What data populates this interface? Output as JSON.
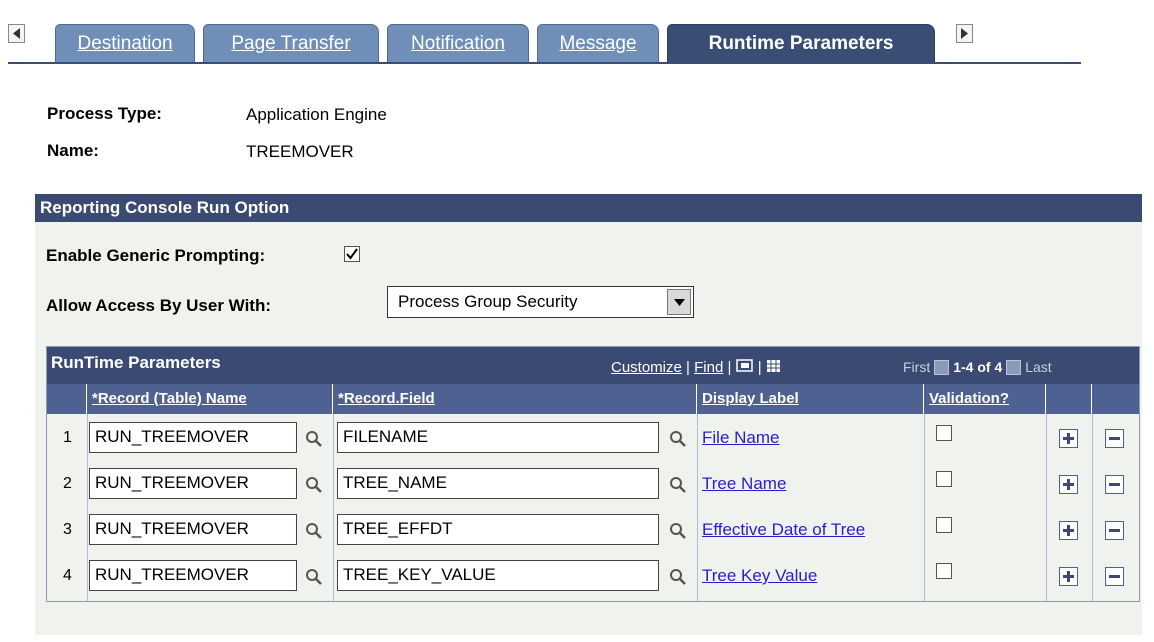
{
  "tabs": {
    "items": [
      {
        "label": "Destination",
        "active": false
      },
      {
        "label": "Page Transfer",
        "active": false
      },
      {
        "label": "Notification",
        "active": false
      },
      {
        "label": "Message",
        "active": false
      },
      {
        "label": "Runtime Parameters",
        "active": true
      }
    ],
    "prev_icon": "triangle-left-icon",
    "next_icon": "triangle-right-icon"
  },
  "info": {
    "process_type_label": "Process Type:",
    "process_type_value": "Application Engine",
    "name_label": "Name:",
    "name_value": "TREEMOVER"
  },
  "section": {
    "title": "Reporting Console Run Option",
    "generic_prompting_label": "Enable Generic Prompting:",
    "generic_prompting_checked": true,
    "access_label": "Allow Access By User With:",
    "access_value": "Process Group Security"
  },
  "grid": {
    "title": "RunTime Parameters",
    "customize": "Customize",
    "find": "Find",
    "sep": "|",
    "first": "First",
    "range": "1-4 of 4",
    "last": "Last",
    "columns": [
      "*Record (Table) Name",
      "*Record.Field",
      "Display Label",
      "Validation?"
    ],
    "rows": [
      {
        "num": "1",
        "record": "RUN_TREEMOVER",
        "field": "FILENAME",
        "label": "File Name",
        "validation": false
      },
      {
        "num": "2",
        "record": "RUN_TREEMOVER",
        "field": "TREE_NAME",
        "label": "Tree Name",
        "validation": false
      },
      {
        "num": "3",
        "record": "RUN_TREEMOVER",
        "field": "TREE_EFFDT",
        "label": "Effective Date of Tree",
        "validation": false
      },
      {
        "num": "4",
        "record": "RUN_TREEMOVER",
        "field": "TREE_KEY_VALUE",
        "label": "Tree Key Value",
        "validation": false
      }
    ]
  },
  "colors": {
    "header_bg": "#3b4a73",
    "column_header_bg": "#4f6191",
    "tab_bg": "#6f8fb8",
    "link": "#2a1ec9",
    "panel_bg": "#f0f2ed"
  }
}
